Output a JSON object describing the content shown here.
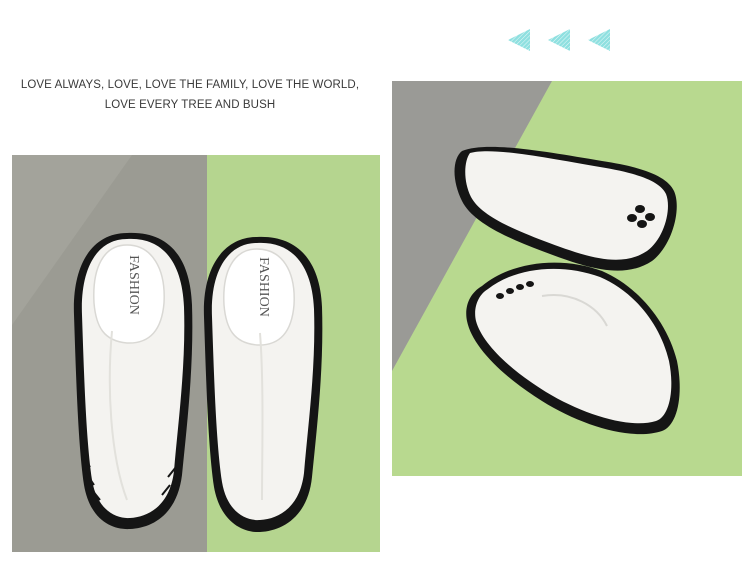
{
  "tagline": {
    "line1": "LOVE ALWAYS, LOVE, LOVE THE FAMILY, LOVE THE WORLD,",
    "line2": "LOVE EVERY TREE AND BUSH"
  },
  "decor": {
    "arrow_color": "#8fe0e0",
    "arrow_count": 3
  },
  "photos": {
    "left": {
      "description_icon": "pair-of-white-shoes-top-view",
      "insole_text": "FASHION",
      "bg_gray": "#9b9b93",
      "bg_green": "#b5d58f"
    },
    "right": {
      "description_icon": "pair-of-white-shoes-side-view",
      "bg_gray": "#9a9a96",
      "bg_green": "#b8d98f"
    }
  },
  "colors": {
    "shoe_white": "#f4f3f0",
    "sole_black": "#151515"
  }
}
